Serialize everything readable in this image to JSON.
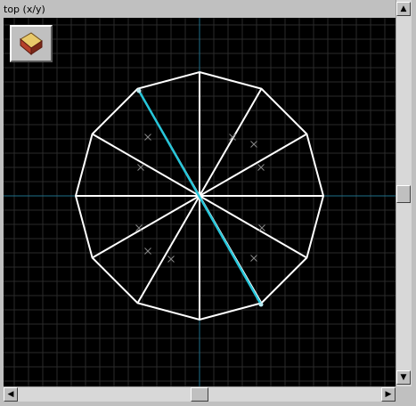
{
  "view": {
    "title": "top (x/y)"
  },
  "toolbar": {
    "tool_icon": "eraser-icon"
  },
  "scrollbars": {
    "vertical": {
      "up_icon": "arrow-up-icon",
      "down_icon": "arrow-down-icon"
    },
    "horizontal": {
      "left_icon": "arrow-left-icon",
      "right_icon": "arrow-right-icon"
    }
  },
  "colors": {
    "background": "#000000",
    "grid": "#2a2a2a",
    "axes": "#1e6f8a",
    "mesh_edges": "#ffffff",
    "selected_edge": "#26c6da",
    "markers": "#8a8a8a",
    "chrome": "#c0c0c0"
  },
  "mesh": {
    "type": "dodecagon-fan",
    "segments": 12,
    "selected_edge": "diagonal"
  }
}
